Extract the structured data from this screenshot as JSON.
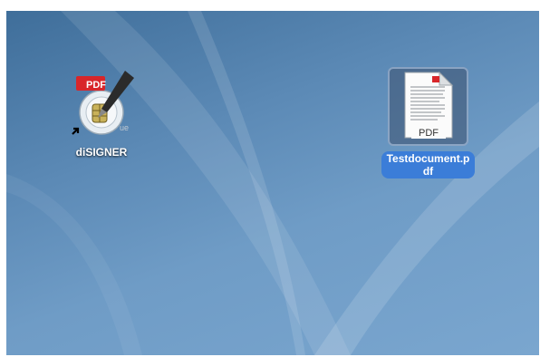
{
  "desktop": {
    "icons": [
      {
        "label": "diSIGNER",
        "badge": "PDF",
        "icon": "disigner-app-icon",
        "alias": true,
        "selected": false
      },
      {
        "label_lines": [
          "Testdocument.p",
          "df"
        ],
        "badge": "PDF",
        "icon": "pdf-document-icon",
        "selected": true
      }
    ]
  }
}
